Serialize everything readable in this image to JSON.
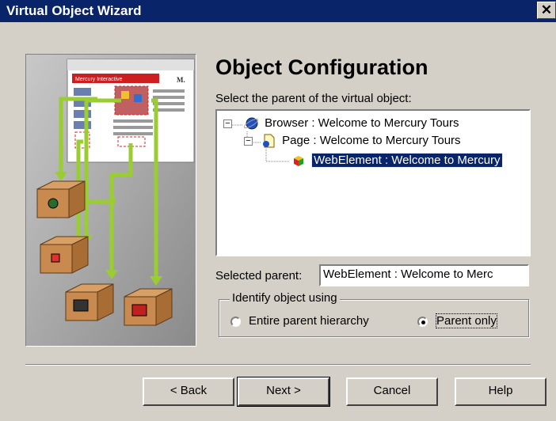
{
  "window": {
    "title": "Virtual Object Wizard"
  },
  "page": {
    "heading": "Object Configuration",
    "tree_label": "Select the parent of the virtual object:",
    "tree": [
      {
        "label": "Browser : Welcome to Mercury Tours",
        "icon": "browser-globe-icon"
      },
      {
        "label": "Page : Welcome to Mercury Tours",
        "icon": "page-icon"
      },
      {
        "label": "WebElement : Welcome to Mercury",
        "icon": "web-element-icon",
        "selected": true
      }
    ],
    "selected_parent_label": "Selected parent:",
    "selected_parent_value": "WebElement : Welcome to Merc",
    "identify_group_label": "Identify object using",
    "radio_entire": "Entire parent hierarchy",
    "radio_parent_only": "Parent only",
    "selected_radio": "Parent only"
  },
  "illustration": {
    "brand_text": "Mercury Interactive",
    "logo_text": "M."
  },
  "buttons": {
    "back": "< Back",
    "next": "Next >",
    "cancel": "Cancel",
    "help": "Help"
  },
  "colors": {
    "titlebar": "#0a246a",
    "dialog": "#d4d0c8",
    "arrow": "#9acd32",
    "selection": "#0a246a"
  }
}
